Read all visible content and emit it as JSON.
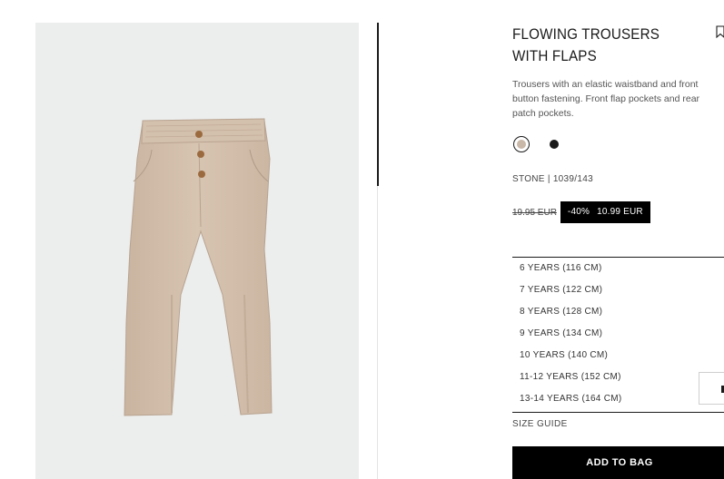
{
  "product": {
    "title": "FLOWING TROUSERS WITH FLAPS",
    "description": "Trousers with an elastic waistband and front button fastening. Front flap pockets and rear patch pockets.",
    "color_ref": "STONE | 1039/143",
    "colors": [
      {
        "name": "stone",
        "hex": "#c9b7a8",
        "selected": true
      },
      {
        "name": "black",
        "hex": "#1a1a1a",
        "selected": false
      }
    ],
    "old_price": "19.95 EUR",
    "discount": "-40%",
    "sale_price": "10.99 EUR"
  },
  "sizes": [
    "6 YEARS (116 CM)",
    "7 YEARS (122 CM)",
    "8 YEARS (128 CM)",
    "9 YEARS (134 CM)",
    "10 YEARS (140 CM)",
    "11-12 YEARS (152 CM)",
    "13-14 YEARS (164 CM)"
  ],
  "size_guide": "SIZE GUIDE",
  "add_to_bag": "ADD TO BAG",
  "icons": {
    "bookmark": "bookmark-icon"
  }
}
